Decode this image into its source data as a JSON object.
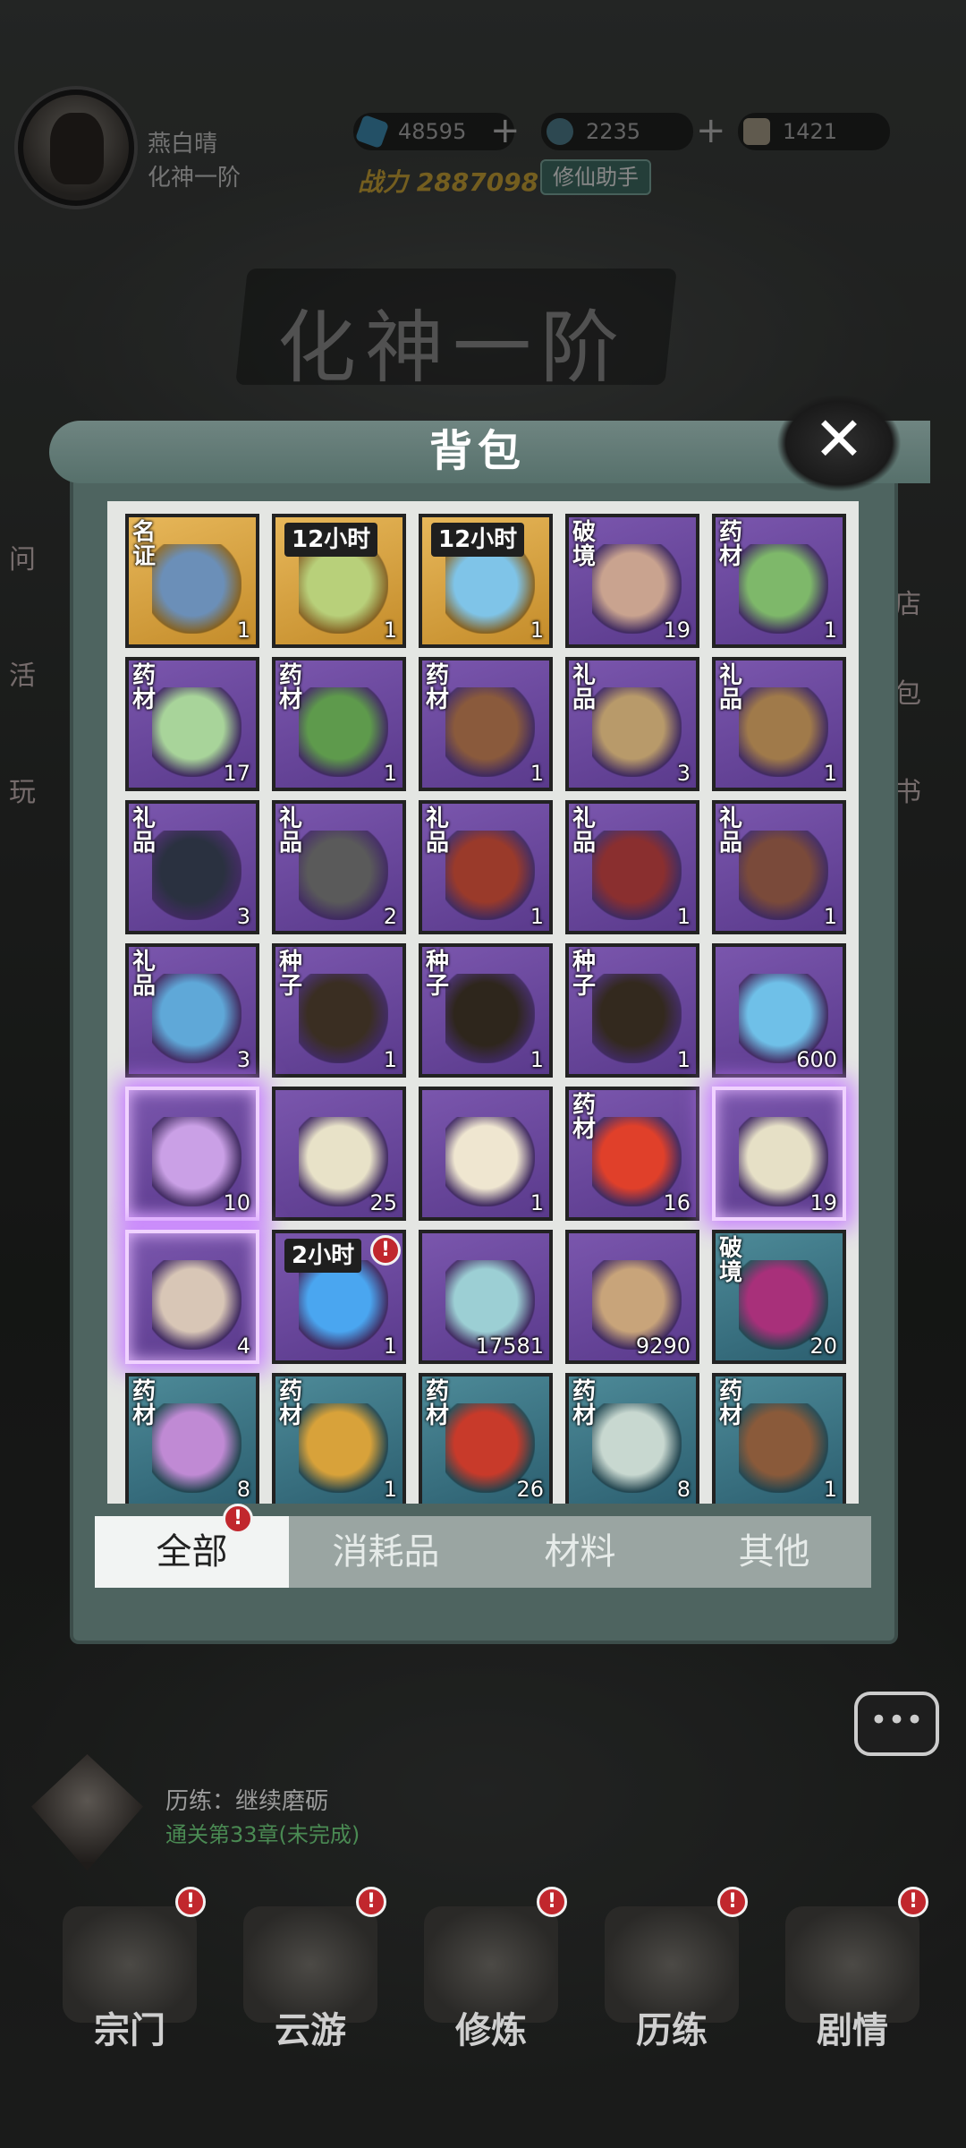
{
  "player": {
    "name": "燕白晴",
    "level": "化神一阶"
  },
  "resources": [
    {
      "value": "48595",
      "icon": "spirit-stone-icon",
      "color": "#3d8ab0"
    },
    {
      "value": "2235",
      "icon": "jade-token-icon",
      "color": "#4f7c8c"
    },
    {
      "value": "1421",
      "icon": "scroll-ticket-icon",
      "color": "#a59c87"
    }
  ],
  "power": {
    "label": "战力",
    "value": "2887098"
  },
  "helper_label": "修仙助手",
  "realm_title": "化神一阶",
  "side_left": [
    "问",
    "活",
    "玩"
  ],
  "side_right": [
    "店",
    "包",
    "书"
  ],
  "bag": {
    "title": "背包",
    "close_icon": "close-icon",
    "items": [
      {
        "tag": "名证",
        "timer": "",
        "qty": "1",
        "bg": "gold",
        "icon": "name-certificate-icon",
        "glow": false,
        "alert": false
      },
      {
        "tag": "",
        "timer": "12小时",
        "qty": "1",
        "bg": "gold",
        "icon": "wind-swirl-icon",
        "glow": false,
        "alert": false
      },
      {
        "tag": "",
        "timer": "12小时",
        "qty": "1",
        "bg": "gold",
        "icon": "blue-crystal-icon",
        "glow": false,
        "alert": false
      },
      {
        "tag": "破境",
        "timer": "",
        "qty": "19",
        "bg": "purple",
        "icon": "crystal-ball-icon",
        "glow": false,
        "alert": false
      },
      {
        "tag": "药材",
        "timer": "",
        "qty": "1",
        "bg": "purple",
        "icon": "herb-leaf-icon",
        "glow": false,
        "alert": false
      },
      {
        "tag": "药材",
        "timer": "",
        "qty": "17",
        "bg": "purple",
        "icon": "succulent-icon",
        "glow": false,
        "alert": false
      },
      {
        "tag": "药材",
        "timer": "",
        "qty": "1",
        "bg": "purple",
        "icon": "sprout-icon",
        "glow": false,
        "alert": false
      },
      {
        "tag": "药材",
        "timer": "",
        "qty": "1",
        "bg": "purple",
        "icon": "nuts-icon",
        "glow": false,
        "alert": false
      },
      {
        "tag": "礼品",
        "timer": "",
        "qty": "3",
        "bg": "purple",
        "icon": "flute-icon",
        "glow": false,
        "alert": false
      },
      {
        "tag": "礼品",
        "timer": "",
        "qty": "1",
        "bg": "purple",
        "icon": "wooden-box-icon",
        "glow": false,
        "alert": false
      },
      {
        "tag": "礼品",
        "timer": "",
        "qty": "3",
        "bg": "purple",
        "icon": "black-vase-icon",
        "glow": false,
        "alert": false
      },
      {
        "tag": "礼品",
        "timer": "",
        "qty": "2",
        "bg": "purple",
        "icon": "iron-ingot-icon",
        "glow": false,
        "alert": false
      },
      {
        "tag": "礼品",
        "timer": "",
        "qty": "1",
        "bg": "purple",
        "icon": "red-pouch-icon",
        "glow": false,
        "alert": false
      },
      {
        "tag": "礼品",
        "timer": "",
        "qty": "1",
        "bg": "purple",
        "icon": "red-vase-icon",
        "glow": false,
        "alert": false
      },
      {
        "tag": "礼品",
        "timer": "",
        "qty": "1",
        "bg": "purple",
        "icon": "spear-icon",
        "glow": false,
        "alert": false
      },
      {
        "tag": "礼品",
        "timer": "",
        "qty": "3",
        "bg": "purple",
        "icon": "blue-gem-icon",
        "glow": false,
        "alert": false
      },
      {
        "tag": "种子",
        "timer": "",
        "qty": "1",
        "bg": "purple",
        "icon": "seed-packet-teal-icon",
        "glow": false,
        "alert": false
      },
      {
        "tag": "种子",
        "timer": "",
        "qty": "1",
        "bg": "purple",
        "icon": "seed-packet-dark-icon",
        "glow": false,
        "alert": false
      },
      {
        "tag": "种子",
        "timer": "",
        "qty": "1",
        "bg": "purple",
        "icon": "seed-packet-sprout-icon",
        "glow": false,
        "alert": false
      },
      {
        "tag": "",
        "timer": "",
        "qty": "600",
        "bg": "purple",
        "icon": "ice-flame-icon",
        "glow": false,
        "alert": false
      },
      {
        "tag": "",
        "timer": "",
        "qty": "10",
        "bg": "purple",
        "icon": "purple-orb-fragment-icon",
        "glow": true,
        "alert": false
      },
      {
        "tag": "",
        "timer": "",
        "qty": "25",
        "bg": "purple",
        "icon": "gourd-icon",
        "glow": false,
        "alert": false
      },
      {
        "tag": "",
        "timer": "",
        "qty": "1",
        "bg": "purple",
        "icon": "money-bag-icon",
        "glow": false,
        "alert": false
      },
      {
        "tag": "药材",
        "timer": "",
        "qty": "16",
        "bg": "purple",
        "icon": "fire-icon",
        "glow": false,
        "alert": false
      },
      {
        "tag": "",
        "timer": "",
        "qty": "19",
        "bg": "purple",
        "icon": "painting-fragment-icon",
        "glow": true,
        "alert": false
      },
      {
        "tag": "",
        "timer": "",
        "qty": "4",
        "bg": "purple",
        "icon": "landscape-fragment-icon",
        "glow": true,
        "alert": false
      },
      {
        "tag": "",
        "timer": "2小时",
        "qty": "1",
        "bg": "purple",
        "icon": "blue-flame-icon",
        "glow": false,
        "alert": true
      },
      {
        "tag": "",
        "timer": "",
        "qty": "17581",
        "bg": "purple",
        "icon": "spirit-orb-icon",
        "glow": false,
        "alert": false
      },
      {
        "tag": "",
        "timer": "",
        "qty": "9290",
        "bg": "purple",
        "icon": "scroll-icon",
        "glow": false,
        "alert": false
      },
      {
        "tag": "破境",
        "timer": "",
        "qty": "20",
        "bg": "teal",
        "icon": "magenta-ball-icon",
        "glow": false,
        "alert": false
      },
      {
        "tag": "药材",
        "timer": "",
        "qty": "8",
        "bg": "teal",
        "icon": "purple-vine-icon",
        "glow": false,
        "alert": false
      },
      {
        "tag": "药材",
        "timer": "",
        "qty": "1",
        "bg": "teal",
        "icon": "golden-pod-icon",
        "glow": false,
        "alert": false
      },
      {
        "tag": "药材",
        "timer": "",
        "qty": "26",
        "bg": "teal",
        "icon": "red-berries-icon",
        "glow": false,
        "alert": false
      },
      {
        "tag": "药材",
        "timer": "",
        "qty": "8",
        "bg": "teal",
        "icon": "grass-icon",
        "glow": false,
        "alert": false
      },
      {
        "tag": "药材",
        "timer": "",
        "qty": "1",
        "bg": "teal",
        "icon": "bark-icon",
        "glow": false,
        "alert": false
      }
    ]
  },
  "tabs": [
    {
      "label": "全部",
      "active": true,
      "alert": true
    },
    {
      "label": "消耗品",
      "active": false,
      "alert": false
    },
    {
      "label": "材料",
      "active": false,
      "alert": false
    },
    {
      "label": "其他",
      "active": false,
      "alert": false
    }
  ],
  "quest": {
    "title": "历练：继续磨砺",
    "progress": "通关第33章(未完成)"
  },
  "nav": [
    {
      "label": "宗门",
      "icon": "sect-gate-icon"
    },
    {
      "label": "云游",
      "icon": "mountain-cloud-icon"
    },
    {
      "label": "修炼",
      "icon": "meditation-icon"
    },
    {
      "label": "历练",
      "icon": "training-scroll-icon"
    },
    {
      "label": "剧情",
      "icon": "story-scroll-icon"
    }
  ]
}
